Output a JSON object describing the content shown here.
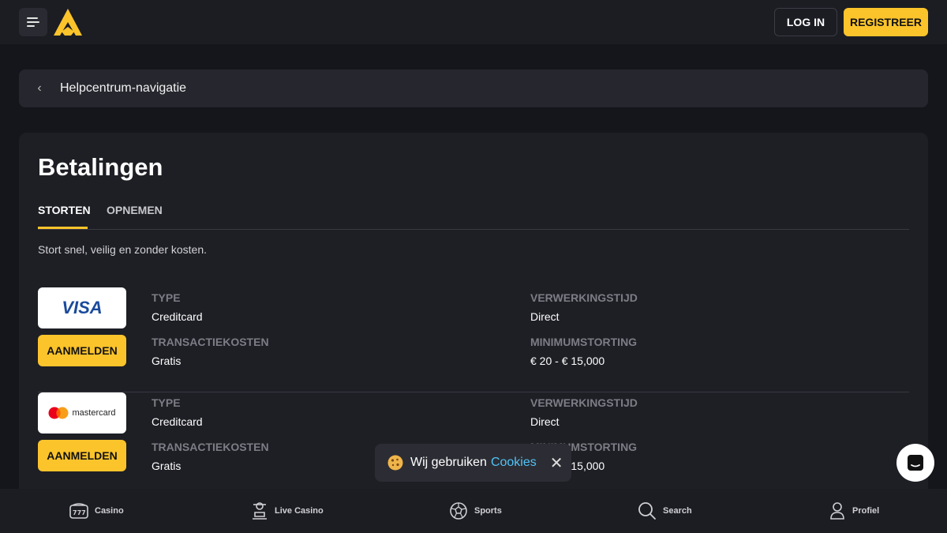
{
  "header": {
    "login_label": "LOG IN",
    "register_label": "REGISTREER",
    "accent_color": "#fcc42b"
  },
  "helpnav": {
    "label": "Helpcentrum-navigatie"
  },
  "page": {
    "title": "Betalingen",
    "tabs": [
      {
        "label": "STORTEN",
        "active": true
      },
      {
        "label": "OPNEMEN",
        "active": false
      }
    ],
    "intro": "Stort snel, veilig en zonder kosten."
  },
  "methods": [
    {
      "logo": "visa-logo",
      "logo_text": "VISA",
      "button_label": "AANMELDEN",
      "type_label": "TYPE",
      "type_value": "Creditcard",
      "time_label": "VERWERKINGSTIJD",
      "time_value": "Direct",
      "fee_label": "TRANSACTIEKOSTEN",
      "fee_value": "Gratis",
      "min_label": "MINIMUMSTORTING",
      "min_value": "€ 20 - € 15,000"
    },
    {
      "logo": "mastercard-logo",
      "logo_text": "mastercard",
      "button_label": "AANMELDEN",
      "type_label": "TYPE",
      "type_value": "Creditcard",
      "time_label": "VERWERKINGSTIJD",
      "time_value": "Direct",
      "fee_label": "TRANSACTIEKOSTEN",
      "fee_value": "Gratis",
      "min_label": "MINIMUMSTORTING",
      "min_value": "€ 20 - € 15,000"
    }
  ],
  "cookie": {
    "text": "Wij gebruiken",
    "link": "Cookies",
    "close": "✕"
  },
  "bottom_nav": [
    {
      "label": "Casino",
      "icon": "slot-machine-icon"
    },
    {
      "label": "Live Casino",
      "icon": "dealer-icon"
    },
    {
      "label": "Sports",
      "icon": "soccer-ball-icon"
    },
    {
      "label": "Search",
      "icon": "search-icon"
    },
    {
      "label": "Profiel",
      "icon": "user-icon"
    }
  ]
}
